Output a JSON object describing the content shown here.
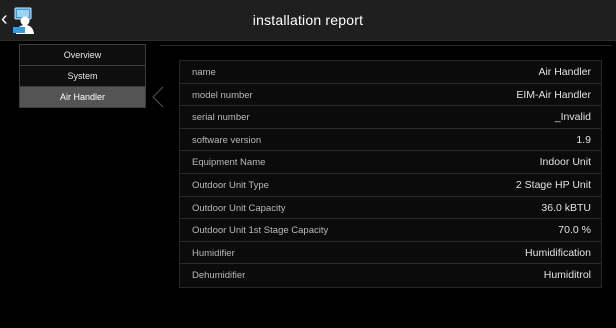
{
  "header": {
    "title": "installation report",
    "back_icon": "chevron-left-icon",
    "tech_icon": "technician-laptop-icon"
  },
  "sidebar": {
    "items": [
      {
        "label": "Overview",
        "active": false
      },
      {
        "label": "System",
        "active": false
      },
      {
        "label": "Air Handler",
        "active": true
      }
    ]
  },
  "details": {
    "rows": [
      {
        "label": "name",
        "value": "Air Handler"
      },
      {
        "label": "model number",
        "value": "EIM-Air Handler"
      },
      {
        "label": "serial number",
        "value": "_Invalid"
      },
      {
        "label": "software version",
        "value": "1.9"
      },
      {
        "label": "Equipment Name",
        "value": "Indoor Unit"
      },
      {
        "label": "Outdoor Unit Type",
        "value": "2 Stage HP Unit"
      },
      {
        "label": "Outdoor Unit Capacity",
        "value": "36.0 kBTU"
      },
      {
        "label": "Outdoor Unit 1st Stage Capacity",
        "value": "70.0 %"
      },
      {
        "label": "Humidifier",
        "value": "Humidification"
      },
      {
        "label": "Dehumidifier",
        "value": "Humiditrol"
      }
    ]
  },
  "colors": {
    "background": "#000000",
    "header": "#1f1f1f",
    "active_item": "#545454",
    "icon_accent": "#3a9ad9"
  }
}
